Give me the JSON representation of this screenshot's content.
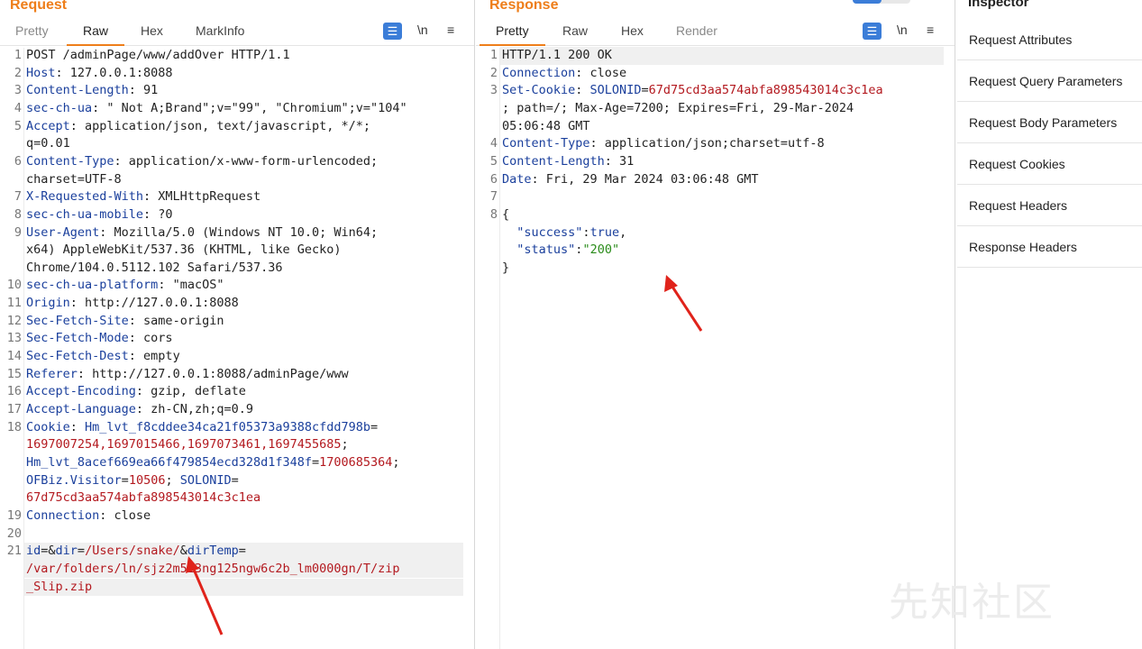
{
  "request": {
    "title": "Request",
    "tabs": [
      "Pretty",
      "Raw",
      "Hex",
      "MarkInfo"
    ],
    "active_tab": "Raw",
    "wrap_label": "\\n",
    "lines": [
      {
        "n": "1",
        "segs": [
          [
            "t",
            "POST /adminPage/www/addOver HTTP/1.1"
          ]
        ]
      },
      {
        "n": "2",
        "segs": [
          [
            "k",
            "Host"
          ],
          [
            "t",
            ": 127.0.0.1:8088"
          ]
        ]
      },
      {
        "n": "3",
        "segs": [
          [
            "k",
            "Content-Length"
          ],
          [
            "t",
            ": 91"
          ]
        ]
      },
      {
        "n": "4",
        "segs": [
          [
            "k",
            "sec-ch-ua"
          ],
          [
            "t",
            ": \" Not A;Brand\";v=\"99\", \"Chromium\";v=\"104\""
          ]
        ]
      },
      {
        "n": "5",
        "segs": [
          [
            "k",
            "Accept"
          ],
          [
            "t",
            ": application/json, text/javascript, */*;"
          ]
        ]
      },
      {
        "n": "",
        "segs": [
          [
            "t",
            "q=0.01"
          ]
        ]
      },
      {
        "n": "6",
        "segs": [
          [
            "k",
            "Content-Type"
          ],
          [
            "t",
            ": application/x-www-form-urlencoded;"
          ]
        ]
      },
      {
        "n": "",
        "segs": [
          [
            "t",
            "charset=UTF-8"
          ]
        ]
      },
      {
        "n": "7",
        "segs": [
          [
            "k",
            "X-Requested-With"
          ],
          [
            "t",
            ": XMLHttpRequest"
          ]
        ]
      },
      {
        "n": "8",
        "segs": [
          [
            "k",
            "sec-ch-ua-mobile"
          ],
          [
            "t",
            ": ?0"
          ]
        ]
      },
      {
        "n": "9",
        "segs": [
          [
            "k",
            "User-Agent"
          ],
          [
            "t",
            ": Mozilla/5.0 (Windows NT 10.0; Win64;"
          ]
        ]
      },
      {
        "n": "",
        "segs": [
          [
            "t",
            "x64) AppleWebKit/537.36 (KHTML, like Gecko)"
          ]
        ]
      },
      {
        "n": "",
        "segs": [
          [
            "t",
            "Chrome/104.0.5112.102 Safari/537.36"
          ]
        ]
      },
      {
        "n": "10",
        "segs": [
          [
            "k",
            "sec-ch-ua-platform"
          ],
          [
            "t",
            ": \"macOS\""
          ]
        ]
      },
      {
        "n": "11",
        "segs": [
          [
            "k",
            "Origin"
          ],
          [
            "t",
            ": http://127.0.0.1:8088"
          ]
        ]
      },
      {
        "n": "12",
        "segs": [
          [
            "k",
            "Sec-Fetch-Site"
          ],
          [
            "t",
            ": same-origin"
          ]
        ]
      },
      {
        "n": "13",
        "segs": [
          [
            "k",
            "Sec-Fetch-Mode"
          ],
          [
            "t",
            ": cors"
          ]
        ]
      },
      {
        "n": "14",
        "segs": [
          [
            "k",
            "Sec-Fetch-Dest"
          ],
          [
            "t",
            ": empty"
          ]
        ]
      },
      {
        "n": "15",
        "segs": [
          [
            "k",
            "Referer"
          ],
          [
            "t",
            ": http://127.0.0.1:8088/adminPage/www"
          ]
        ]
      },
      {
        "n": "16",
        "segs": [
          [
            "k",
            "Accept-Encoding"
          ],
          [
            "t",
            ": gzip, deflate"
          ]
        ]
      },
      {
        "n": "17",
        "segs": [
          [
            "k",
            "Accept-Language"
          ],
          [
            "t",
            ": zh-CN,zh;q=0.9"
          ]
        ]
      },
      {
        "n": "18",
        "segs": [
          [
            "k",
            "Cookie"
          ],
          [
            "t",
            ": "
          ],
          [
            "k",
            "Hm_lvt_f8cddee34ca21f05373a9388cfdd798b"
          ],
          [
            "t",
            "="
          ]
        ]
      },
      {
        "n": "",
        "segs": [
          [
            "v",
            "1697007254,1697015466,1697073461,1697455685"
          ],
          [
            "t",
            "; "
          ]
        ]
      },
      {
        "n": "",
        "segs": [
          [
            "k",
            "Hm_lvt_8acef669ea66f479854ecd328d1f348f"
          ],
          [
            "t",
            "="
          ],
          [
            "v",
            "1700685364"
          ],
          [
            "t",
            ";"
          ]
        ]
      },
      {
        "n": "",
        "segs": [
          [
            "k",
            "OFBiz.Visitor"
          ],
          [
            "t",
            "="
          ],
          [
            "v",
            "10506"
          ],
          [
            "t",
            "; "
          ],
          [
            "k",
            "SOLONID"
          ],
          [
            "t",
            "="
          ]
        ]
      },
      {
        "n": "",
        "segs": [
          [
            "v",
            "67d75cd3aa574abfa898543014c3c1ea"
          ]
        ]
      },
      {
        "n": "19",
        "segs": [
          [
            "k",
            "Connection"
          ],
          [
            "t",
            ": close"
          ]
        ]
      },
      {
        "n": "20",
        "segs": []
      },
      {
        "n": "21",
        "segs": [
          [
            "k",
            "id"
          ],
          [
            "t",
            "=&"
          ],
          [
            "k",
            "dir"
          ],
          [
            "t",
            "="
          ],
          [
            "v",
            "/Users/snake/"
          ],
          [
            "t",
            "&"
          ],
          [
            "k",
            "dirTemp"
          ],
          [
            "t",
            "="
          ]
        ]
      },
      {
        "n": "",
        "segs": [
          [
            "v",
            "/var/folders/ln/sjz2m513ng125ngw6c2b_lm0000gn/T/zip"
          ]
        ]
      },
      {
        "n": "",
        "segs": [
          [
            "v",
            "_Slip.zip"
          ]
        ]
      }
    ]
  },
  "response": {
    "title": "Response",
    "tabs": [
      "Pretty",
      "Raw",
      "Hex",
      "Render"
    ],
    "active_tab": "Pretty",
    "wrap_label": "\\n",
    "lines": [
      {
        "n": "1",
        "segs": [
          [
            "t",
            "HTTP/1.1 200 OK"
          ]
        ]
      },
      {
        "n": "2",
        "segs": [
          [
            "k",
            "Connection"
          ],
          [
            "t",
            ": close"
          ]
        ]
      },
      {
        "n": "3",
        "segs": [
          [
            "k",
            "Set-Cookie"
          ],
          [
            "t",
            ": "
          ],
          [
            "k",
            "SOLONID"
          ],
          [
            "t",
            "="
          ],
          [
            "v",
            "67d75cd3aa574abfa898543014c3c1ea"
          ]
        ]
      },
      {
        "n": "",
        "segs": [
          [
            "t",
            "; path=/; Max-Age=7200; Expires=Fri, 29-Mar-2024"
          ]
        ]
      },
      {
        "n": "",
        "segs": [
          [
            "t",
            "05:06:48 GMT"
          ]
        ]
      },
      {
        "n": "4",
        "segs": [
          [
            "k",
            "Content-Type"
          ],
          [
            "t",
            ": application/json;charset=utf-8"
          ]
        ]
      },
      {
        "n": "5",
        "segs": [
          [
            "k",
            "Content-Length"
          ],
          [
            "t",
            ": 31"
          ]
        ]
      },
      {
        "n": "6",
        "segs": [
          [
            "k",
            "Date"
          ],
          [
            "t",
            ": Fri, 29 Mar 2024 03:06:48 GMT"
          ]
        ]
      },
      {
        "n": "7",
        "segs": []
      },
      {
        "n": "8",
        "segs": [
          [
            "t",
            "{"
          ]
        ]
      },
      {
        "n": "",
        "segs": [
          [
            "t",
            "  "
          ],
          [
            "k",
            "\"success\""
          ],
          [
            "t",
            ":"
          ],
          [
            "k",
            "true"
          ],
          [
            "t",
            ","
          ]
        ]
      },
      {
        "n": "",
        "segs": [
          [
            "t",
            "  "
          ],
          [
            "k",
            "\"status\""
          ],
          [
            "t",
            ":"
          ],
          [
            "g",
            "\"200\""
          ]
        ]
      },
      {
        "n": "",
        "segs": [
          [
            "t",
            "}"
          ]
        ]
      }
    ]
  },
  "inspector": {
    "title": "Inspector",
    "items": [
      "Request Attributes",
      "Request Query Parameters",
      "Request Body Parameters",
      "Request Cookies",
      "Request Headers",
      "Response Headers"
    ]
  },
  "watermark": "先知社区",
  "colors": {
    "accent": "#ee7e1a",
    "key": "#1a3f9c",
    "value": "#b3191f",
    "green": "#2a8c1a",
    "arrow": "#e0231b"
  }
}
